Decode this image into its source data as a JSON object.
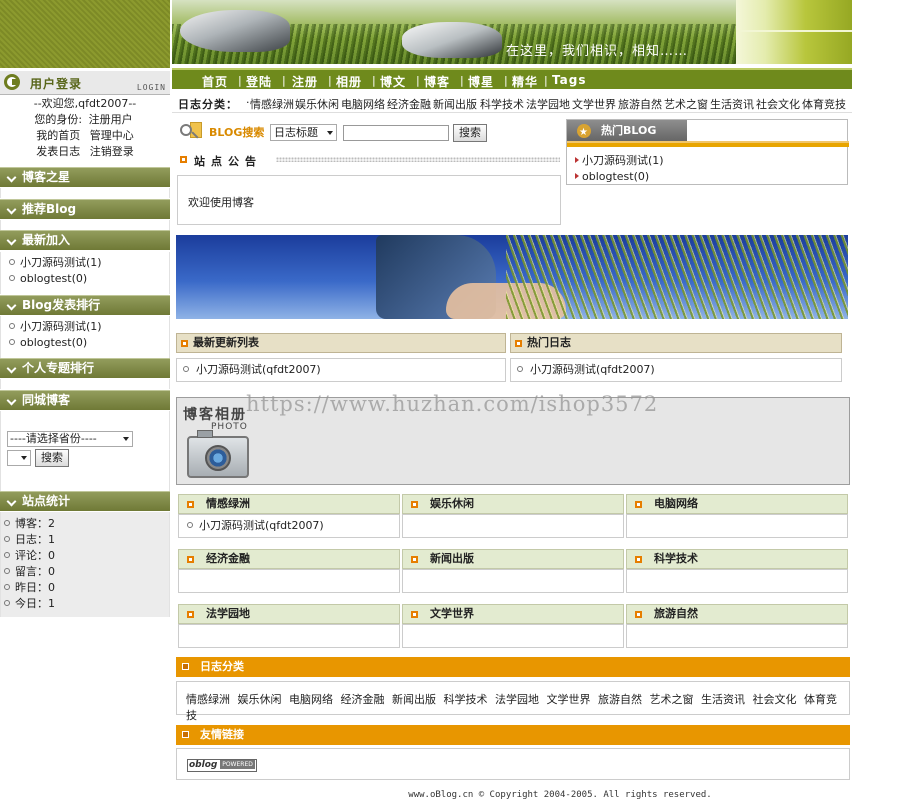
{
  "header": {
    "slogan": "在这里，我们相识，相知……"
  },
  "login": {
    "title": "用户登录",
    "title_en": "LOGIN",
    "welcome": "--欢迎您,qfdt2007--",
    "identity_label": "您的身份:",
    "identity_value": "注册用户",
    "links": [
      "我的首页",
      "管理中心",
      "发表日志",
      "注销登录"
    ]
  },
  "sidebar": {
    "star": "博客之星",
    "recommend": "推荐Blog",
    "newest": {
      "title": "最新加入",
      "items": [
        "小刀源码测试(1)",
        "oblogtest(0)"
      ]
    },
    "ranking": {
      "title": "Blog发表排行",
      "items": [
        "小刀源码测试(1)",
        "oblogtest(0)"
      ]
    },
    "topic": "个人专题排行",
    "city": {
      "title": "同城博客",
      "province": "----请选择省份----",
      "button": "搜索"
    },
    "stats": {
      "title": "站点统计",
      "items": [
        "博客：2",
        "日志：1",
        "评论：0",
        "留言：0",
        "昨日：0",
        "今日：1"
      ]
    }
  },
  "nav": [
    "首页",
    "登陆",
    "注册",
    "相册",
    "博文",
    "博客",
    "博星",
    "精华",
    "Tags"
  ],
  "categories_bar": {
    "label": "日志分类：",
    "items": [
      "情感绿洲",
      "娱乐休闲",
      "电脑网络",
      "经济金融",
      "新闻出版",
      "科学技术",
      "法学园地",
      "文学世界",
      "旅游自然",
      "艺术之窗",
      "生活资讯",
      "社会文化",
      "体育竞技"
    ]
  },
  "search": {
    "label": "BLOG搜索",
    "select": "日志标题",
    "button": "搜索"
  },
  "notice": {
    "title": "站点公告",
    "content": "欢迎使用博客"
  },
  "hot_blog": {
    "title": "热门BLOG",
    "items": [
      "小刀源码测试(1)",
      "oblogtest(0)"
    ]
  },
  "latest": {
    "title": "最新更新列表",
    "item": "小刀源码测试(qfdt2007)"
  },
  "hot_log": {
    "title": "热门日志",
    "item": "小刀源码测试(qfdt2007)"
  },
  "album": {
    "title": "博客相册",
    "title_en": "PHOTO"
  },
  "watermark": "https://www.huzhan.com/ishop3572",
  "grid": [
    {
      "title": "情感绿洲",
      "item": "小刀源码测试(qfdt2007)"
    },
    {
      "title": "娱乐休闲",
      "item": ""
    },
    {
      "title": "电脑网络",
      "item": ""
    },
    {
      "title": "经济金融",
      "item": ""
    },
    {
      "title": "新闻出版",
      "item": ""
    },
    {
      "title": "科学技术",
      "item": ""
    },
    {
      "title": "法学园地",
      "item": ""
    },
    {
      "title": "文学世界",
      "item": ""
    },
    {
      "title": "旅游自然",
      "item": ""
    }
  ],
  "log_categories": {
    "title": "日志分类",
    "items": [
      "情感绿洲",
      "娱乐休闲",
      "电脑网络",
      "经济金融",
      "新闻出版",
      "科学技术",
      "法学园地",
      "文学世界",
      "旅游自然",
      "艺术之窗",
      "生活资讯",
      "社会文化",
      "体育竞技"
    ]
  },
  "links": {
    "title": "友情链接",
    "logo_text": "oblog",
    "logo_badge": "POWERED"
  },
  "footer": "www.oBlog.cn © Copyright 2004-2005. All rights reserved."
}
